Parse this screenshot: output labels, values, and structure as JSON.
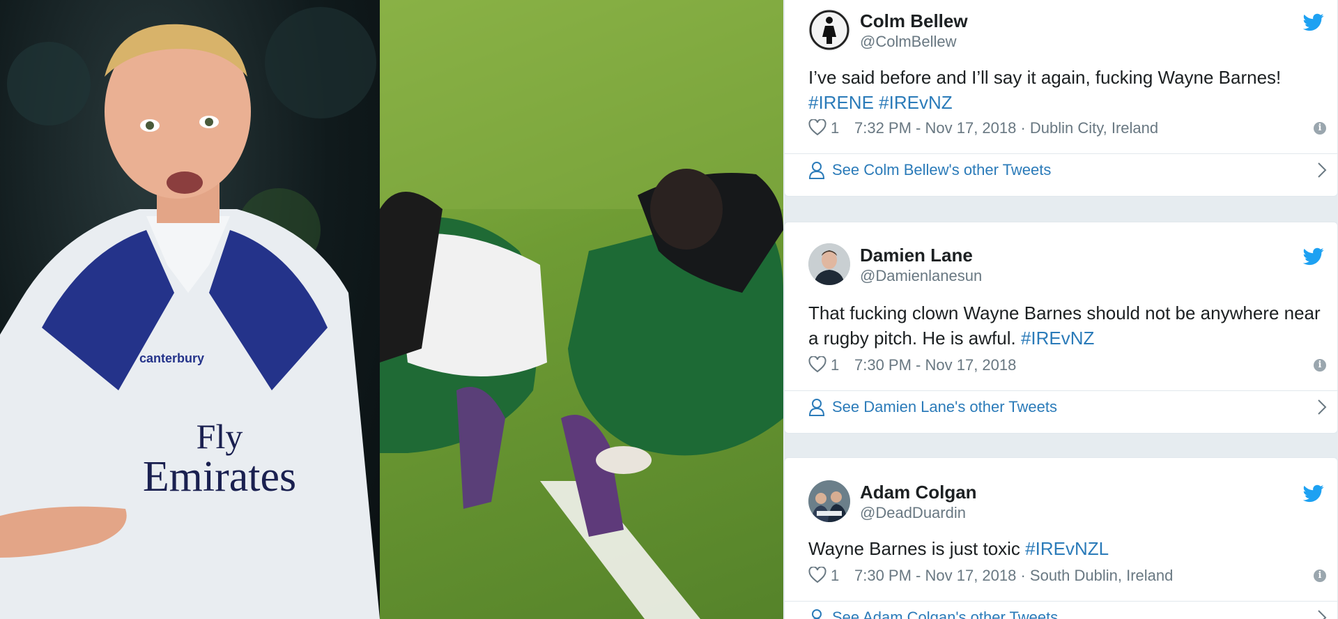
{
  "tweets": [
    {
      "name": "Colm Bellew",
      "handle": "@ColmBellew",
      "text": "I’ve said before and I’ll say it again, fucking Wayne Barnes!",
      "hashtags": [
        "#IRENE",
        "#IREvNZ"
      ],
      "likes": "1",
      "time": "7:32 PM - Nov 17, 2018 · Dublin City, Ireland",
      "see_more": "See Colm Bellew's other Tweets"
    },
    {
      "name": "Damien Lane",
      "handle": "@Damienlanesun",
      "text_line1": "That fucking clown Wayne Barnes should not be anywhere near",
      "text_line2": "a rugby pitch. He is awful.",
      "hashtags": [
        "#IREvNZ"
      ],
      "likes": "1",
      "time": "7:30 PM - Nov 17, 2018",
      "see_more": "See Damien Lane's other Tweets"
    },
    {
      "name": "Adam Colgan",
      "handle": "@DeadDuardin",
      "text": "Wayne Barnes is just toxic",
      "hashtags": [
        "#IREvNZL"
      ],
      "likes": "1",
      "time": "7:30 PM - Nov 17, 2018 · South Dublin, Ireland",
      "see_more": "See Adam Colgan's other Tweets"
    }
  ],
  "photos": {
    "left_shirt_text_line1": "Fly",
    "left_shirt_text_line2": "Emirates"
  },
  "icons": {
    "like": "heart-icon",
    "info": "info-icon",
    "profile": "person-icon",
    "chevron": "chevron-right-icon",
    "brand": "twitter-bird-icon"
  },
  "colors": {
    "link": "#2b7bb9",
    "twitter_blue": "#1da1f2",
    "secondary_text": "#697882",
    "border": "#e1e8ed",
    "background": "#e6ecf0"
  }
}
